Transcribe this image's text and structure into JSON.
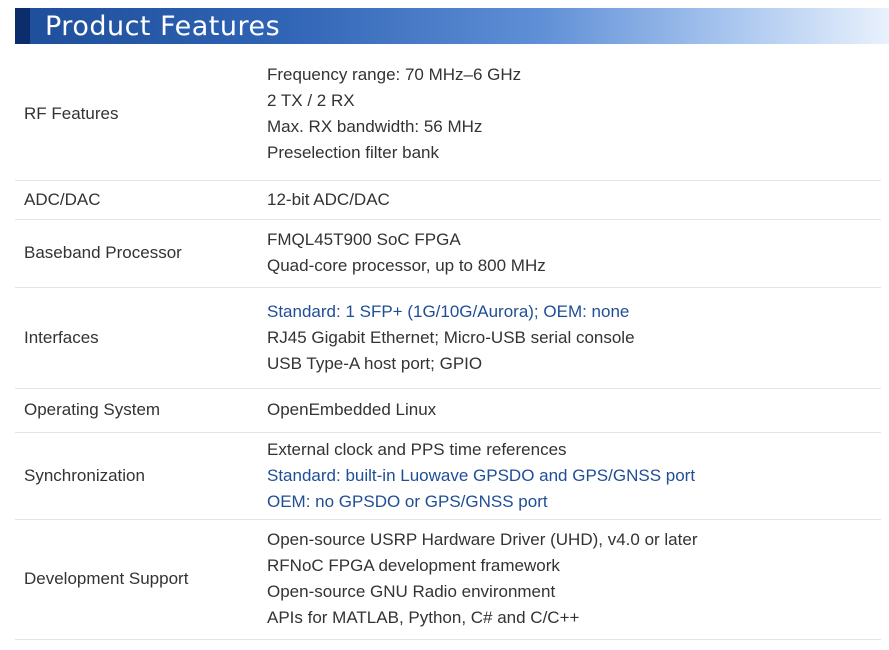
{
  "header": {
    "title": "Product Features"
  },
  "rows": [
    {
      "label": "RF Features",
      "lines": [
        {
          "text": "Frequency range: 70 MHz–6 GHz",
          "hl": false
        },
        {
          "text": "2 TX / 2 RX",
          "hl": false
        },
        {
          "text": "Max. RX bandwidth: 56 MHz",
          "hl": false
        },
        {
          "text": "Preselection filter bank",
          "hl": false
        }
      ]
    },
    {
      "label": "ADC/DAC",
      "lines": [
        {
          "text": "12-bit ADC/DAC",
          "hl": false
        }
      ]
    },
    {
      "label": "Baseband Processor",
      "lines": [
        {
          "text": "FMQL45T900 SoC FPGA",
          "hl": false
        },
        {
          "text": "Quad-core processor, up to 800 MHz",
          "hl": false
        }
      ]
    },
    {
      "label": "Interfaces",
      "lines": [
        {
          "text": "Standard: 1 SFP+ (1G/10G/Aurora); OEM: none",
          "hl": true
        },
        {
          "text": "RJ45 Gigabit Ethernet; Micro-USB serial console",
          "hl": false
        },
        {
          "text": "USB Type-A host port; GPIO",
          "hl": false
        }
      ]
    },
    {
      "label": "Operating System",
      "lines": [
        {
          "text": "OpenEmbedded Linux",
          "hl": false
        }
      ]
    },
    {
      "label": "Synchronization",
      "lines": [
        {
          "text": "External clock and PPS time references",
          "hl": false
        },
        {
          "text": "Standard: built-in Luowave GPSDO and GPS/GNSS port",
          "hl": true
        },
        {
          "text": "OEM: no GPSDO or GPS/GNSS port",
          "hl": true
        }
      ]
    },
    {
      "label": "Development Support",
      "lines": [
        {
          "text": "Open-source USRP Hardware Driver (UHD), v4.0 or later",
          "hl": false
        },
        {
          "text": "RFNoC FPGA development framework",
          "hl": false
        },
        {
          "text": "Open-source GNU Radio environment",
          "hl": false
        },
        {
          "text": "APIs for MATLAB, Python, C# and C/C++",
          "hl": false
        }
      ]
    }
  ]
}
